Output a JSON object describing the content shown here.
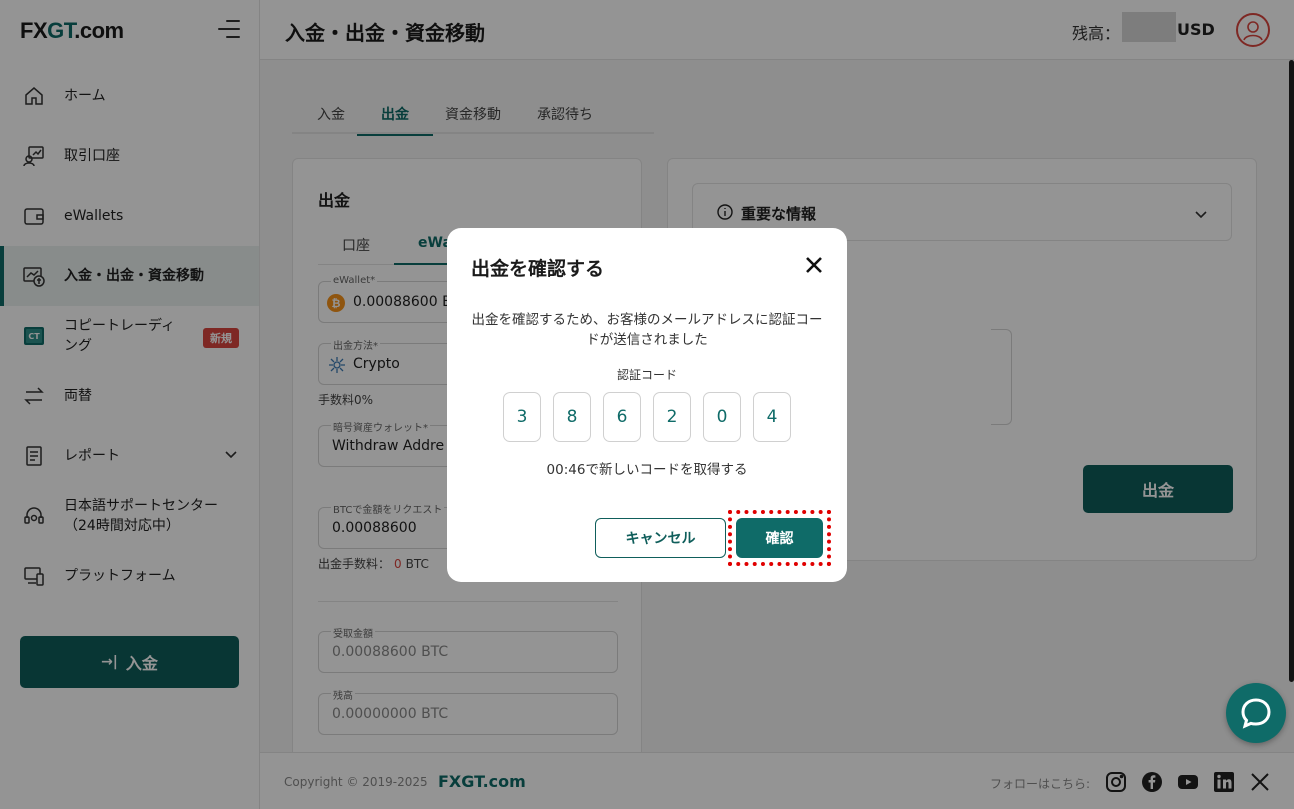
{
  "app": {
    "logo_prefix": "FX",
    "logo_g": "GT",
    "logo_suffix": ".com"
  },
  "sidebar": {
    "items": [
      {
        "label": "ホーム",
        "icon": "home-icon"
      },
      {
        "label": "取引口座",
        "icon": "trading-account-icon"
      },
      {
        "label": "eWallets",
        "icon": "wallet-icon"
      },
      {
        "label": "入金・出金・資金移動",
        "icon": "funds-transfer-icon",
        "active": true
      },
      {
        "label_line1": "コピートレーディ",
        "label_line2": "ング",
        "icon": "copy-trading-icon",
        "badge": "新規"
      },
      {
        "label": "両替",
        "icon": "exchange-icon"
      },
      {
        "label": "レポート",
        "icon": "report-icon"
      },
      {
        "label_line1": "日本語サポートセンター",
        "label_line2": "（24時間対応中）",
        "icon": "support-icon"
      },
      {
        "label": "プラットフォーム",
        "icon": "platform-icon"
      }
    ],
    "deposit_button": "入金"
  },
  "header": {
    "title": "入金・出金・資金移動",
    "balance_label": "残高：",
    "currency": "USD"
  },
  "tabs": [
    "入金",
    "出金",
    "資金移動",
    "承認待ち"
  ],
  "withdraw_card": {
    "title": "出金",
    "subtabs": [
      "口座",
      "eWa"
    ],
    "ewallet_label": "eWallet*",
    "ewallet_value": "0.00088600 B",
    "method_label": "出金方法*",
    "method_value": "Crypto",
    "fee_rate": "手数料0%",
    "wallet_label": "暗号資産ウォレット*",
    "wallet_value": "Withdraw Addre",
    "amount_label": "BTCで金額をリクエスト",
    "amount_value": "0.00088600",
    "fee_label": "出金手数料：",
    "fee_value": "0",
    "fee_unit": "BTC",
    "received_label": "受取金額",
    "received_value": "0.00088600 BTC",
    "balance_label": "残高",
    "balance_value": "0.00000000 BTC"
  },
  "info_card": {
    "important_info": "重要な情報",
    "withdraw_button": "出金"
  },
  "footer": {
    "copyright": "Copyright © 2019-2025",
    "brand": "FXGT.com",
    "follow": "フォローはこちら:"
  },
  "modal": {
    "title": "出金を確認する",
    "message": "出金を確認するため、お客様のメールアドレスに認証コードが送信されました",
    "code_label": "認証コード",
    "code_digits": [
      "3",
      "8",
      "6",
      "2",
      "0",
      "4"
    ],
    "resend": "00:46で新しいコードを取得する",
    "cancel": "キャンセル",
    "confirm": "確認"
  },
  "colors": {
    "brand": "#0f6b68",
    "badge": "#d9453f",
    "highlight": "#e00000"
  }
}
